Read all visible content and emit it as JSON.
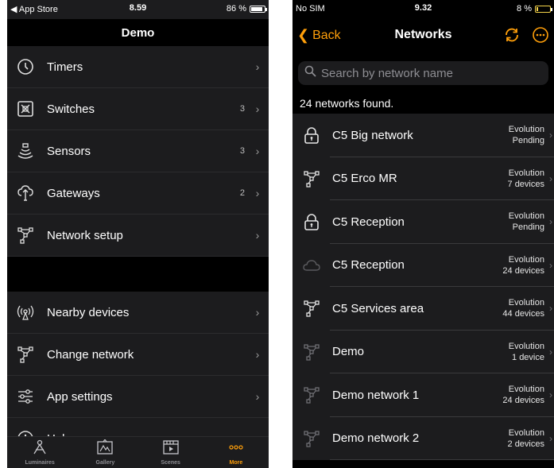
{
  "colors": {
    "accent": "#ff9f0a",
    "background_dark": "#1c1c1e",
    "black": "#000000"
  },
  "left_phone": {
    "status": {
      "back_app": "◀ App Store",
      "time": "8.59",
      "battery": "86 %",
      "battery_level": 0.86
    },
    "nav_title": "Demo",
    "menu_group_1": [
      {
        "label": "Timers",
        "count": "",
        "icon": "clock-icon"
      },
      {
        "label": "Switches",
        "count": "3",
        "icon": "switch-icon"
      },
      {
        "label": "Sensors",
        "count": "3",
        "icon": "sensor-icon"
      },
      {
        "label": "Gateways",
        "count": "2",
        "icon": "gateway-icon"
      },
      {
        "label": "Network setup",
        "count": "",
        "icon": "network-icon"
      }
    ],
    "menu_group_2": [
      {
        "label": "Nearby devices",
        "count": "",
        "icon": "nearby-icon"
      },
      {
        "label": "Change network",
        "count": "",
        "icon": "network-icon"
      },
      {
        "label": "App settings",
        "count": "",
        "icon": "settings-sliders-icon"
      },
      {
        "label": "Help",
        "count": "",
        "icon": "info-icon"
      }
    ],
    "tabs": [
      {
        "label": "Luminaires",
        "icon": "luminaire-icon",
        "active": false
      },
      {
        "label": "Gallery",
        "icon": "gallery-icon",
        "active": false
      },
      {
        "label": "Scenes",
        "icon": "scenes-icon",
        "active": false
      },
      {
        "label": "More",
        "icon": "more-icon",
        "active": true
      }
    ]
  },
  "right_phone": {
    "status": {
      "carrier": "No SIM",
      "time": "9.32",
      "battery": "8 %",
      "battery_level": 0.08
    },
    "back_label": "Back",
    "nav_title": "Networks",
    "search_placeholder": "Search by network name",
    "found_text": "24 networks found.",
    "networks": [
      {
        "name": "C5 Big network",
        "type": "Evolution",
        "status": "Pending",
        "icon": "lock-icon"
      },
      {
        "name": "C5 Erco MR",
        "type": "Evolution",
        "status": "7 devices",
        "icon": "network-icon"
      },
      {
        "name": "C5 Reception",
        "type": "Evolution",
        "status": "Pending",
        "icon": "lock-icon"
      },
      {
        "name": "C5 Reception",
        "type": "Evolution",
        "status": "24 devices",
        "icon": "cloud-icon"
      },
      {
        "name": "C5 Services area",
        "type": "Evolution",
        "status": "44 devices",
        "icon": "network-icon"
      },
      {
        "name": "Demo",
        "type": "Evolution",
        "status": "1 device",
        "icon": "network-dim-icon"
      },
      {
        "name": "Demo network 1",
        "type": "Evolution",
        "status": "24 devices",
        "icon": "network-dim-icon"
      },
      {
        "name": "Demo network 2",
        "type": "Evolution",
        "status": "2 devices",
        "icon": "network-dim-icon"
      }
    ]
  }
}
